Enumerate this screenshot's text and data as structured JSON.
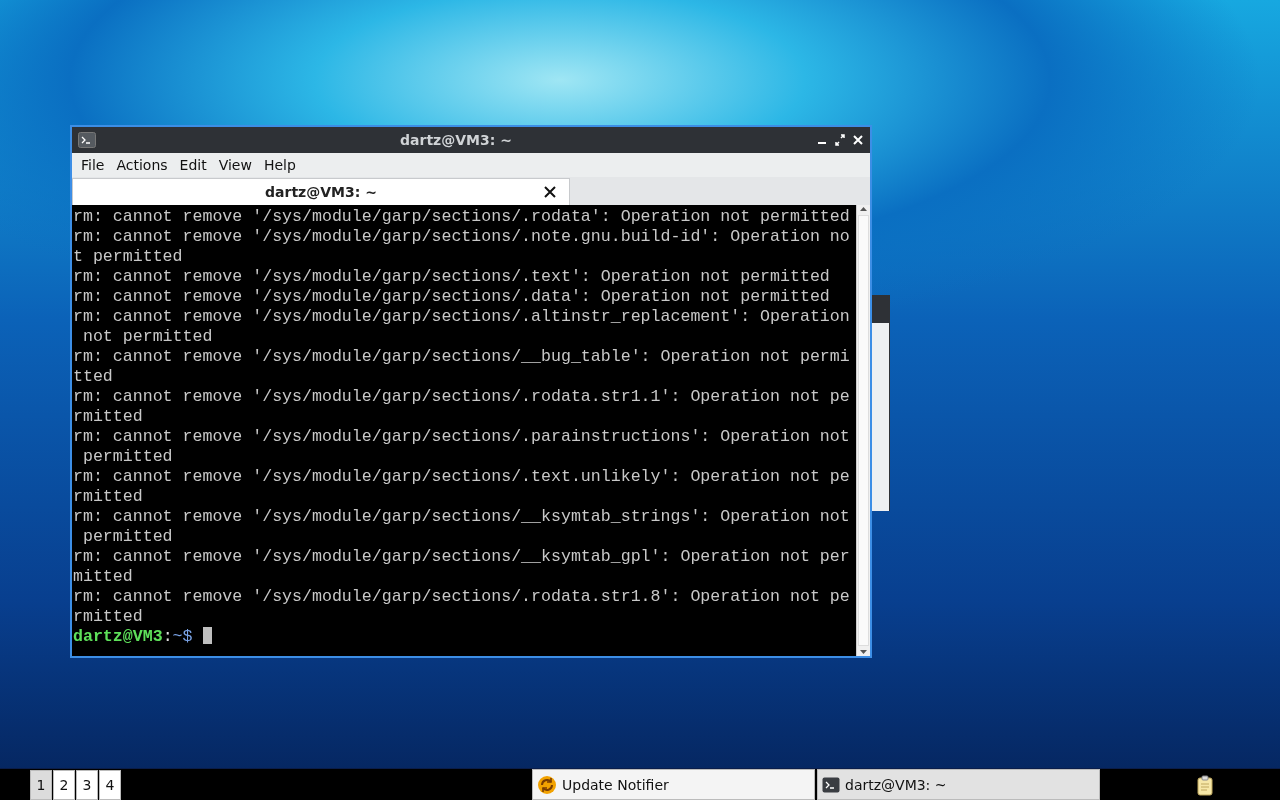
{
  "terminal_window": {
    "title": "dartz@VM3: ~",
    "menu": [
      "File",
      "Actions",
      "Edit",
      "View",
      "Help"
    ],
    "tabs": [
      {
        "label": "dartz@VM3: ~",
        "selected": true
      }
    ],
    "lines": [
      "rm: cannot remove '/sys/module/garp/sections/.rodata': Operation not permitted",
      "rm: cannot remove '/sys/module/garp/sections/.note.gnu.build-id': Operation no",
      "t permitted",
      "rm: cannot remove '/sys/module/garp/sections/.text': Operation not permitted",
      "rm: cannot remove '/sys/module/garp/sections/.data': Operation not permitted",
      "rm: cannot remove '/sys/module/garp/sections/.altinstr_replacement': Operation",
      " not permitted",
      "rm: cannot remove '/sys/module/garp/sections/__bug_table': Operation not permi",
      "tted",
      "rm: cannot remove '/sys/module/garp/sections/.rodata.str1.1': Operation not pe",
      "rmitted",
      "rm: cannot remove '/sys/module/garp/sections/.parainstructions': Operation not",
      " permitted",
      "rm: cannot remove '/sys/module/garp/sections/.text.unlikely': Operation not pe",
      "rmitted",
      "rm: cannot remove '/sys/module/garp/sections/__ksymtab_strings': Operation not",
      " permitted",
      "rm: cannot remove '/sys/module/garp/sections/__ksymtab_gpl': Operation not per",
      "mitted",
      "rm: cannot remove '/sys/module/garp/sections/.rodata.str1.8': Operation not pe",
      "rmitted"
    ],
    "prompt": {
      "user": "dartz@VM3",
      "separator": ":",
      "path": "~$"
    }
  },
  "taskbar": {
    "workspaces": [
      {
        "label": "1",
        "selected": true
      },
      {
        "label": "2",
        "selected": false
      },
      {
        "label": "3",
        "selected": false
      },
      {
        "label": "4",
        "selected": false
      }
    ],
    "tasks": [
      {
        "label": "Update Notifier",
        "kind": "updater"
      },
      {
        "label": "dartz@VM3: ~",
        "kind": "terminal"
      }
    ]
  }
}
